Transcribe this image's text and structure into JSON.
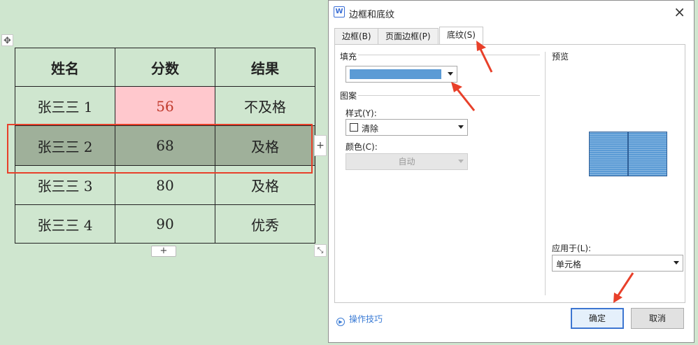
{
  "table": {
    "headers": [
      "姓名",
      "分数",
      "结果"
    ],
    "rows": [
      [
        "张三三 1",
        "56",
        "不及格"
      ],
      [
        "张三三 2",
        "68",
        "及格"
      ],
      [
        "张三三 3",
        "80",
        "及格"
      ],
      [
        "张三三 4",
        "90",
        "优秀"
      ]
    ],
    "add_symbol": "+"
  },
  "dialog": {
    "title": "边框和底纹",
    "app_icon_letter": "W",
    "close_symbol": "×",
    "tabs": [
      "边框(B)",
      "页面边框(P)",
      "底纹(S)"
    ],
    "active_tab": "底纹(S)",
    "fill": {
      "label": "填充",
      "color": "#5b9bd5"
    },
    "pattern": {
      "label": "图案",
      "style_label": "样式(Y):",
      "style_value": "清除",
      "color_label": "颜色(C):",
      "color_value": "自动"
    },
    "preview": {
      "label": "预览"
    },
    "apply_to": {
      "label": "应用于(L):",
      "value": "单元格"
    },
    "tips_label": "操作技巧",
    "ok_label": "确定",
    "cancel_label": "取消"
  },
  "colors": {
    "background": "#cfe6cf",
    "highlight_border": "#e8402a",
    "selected_row": "#9fb09a",
    "fail_cell": "#ffc8cd",
    "fill_blue": "#5b9bd5"
  }
}
